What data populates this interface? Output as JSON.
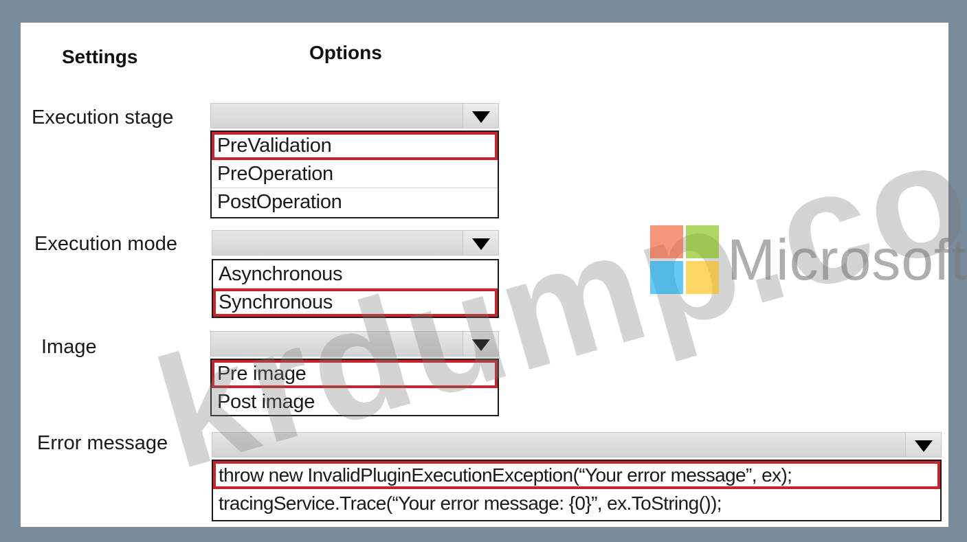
{
  "headers": {
    "settings": "Settings",
    "options": "Options"
  },
  "rows": [
    {
      "label": "Execution stage",
      "options": [
        "PreValidation",
        "PreOperation",
        "PostOperation"
      ],
      "selected": 0
    },
    {
      "label": "Execution mode",
      "options": [
        "Asynchronous",
        "Synchronous"
      ],
      "selected": 1
    },
    {
      "label": "Image",
      "options": [
        "Pre image",
        "Post image"
      ],
      "selected": 0
    },
    {
      "label": "Error message",
      "options": [
        "throw new InvalidPluginExecutionException(“Your error message”, ex);",
        "tracingService.Trace(“Your error message: {0}”, ex.ToString());"
      ],
      "selected": 0
    }
  ],
  "watermark": {
    "text": "krdump.com",
    "brand": "Microsoft"
  },
  "colors": {
    "frame": "#788b9c",
    "highlight": "#c8242b",
    "ms_red": "#f25022",
    "ms_green": "#7fba00",
    "ms_blue": "#00a4ef",
    "ms_yellow": "#ffb900"
  },
  "icons": {
    "dropdown": "triangle-down-icon"
  }
}
